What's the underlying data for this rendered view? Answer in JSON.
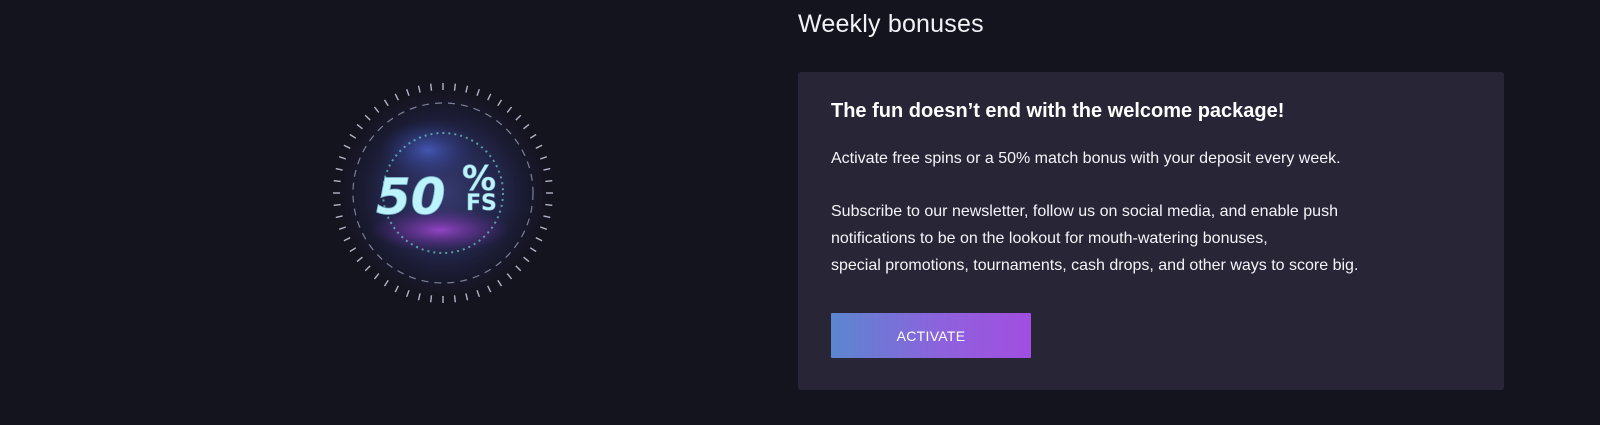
{
  "section": {
    "title": "Weekly bonuses"
  },
  "promo_art": {
    "number": "50",
    "percent_sign": "%",
    "suffix": "FS"
  },
  "card": {
    "heading": "The fun doesn’t end with the welcome package!",
    "paragraph_1": "Activate free spins or a 50% match bonus with your deposit every week.",
    "paragraph_2_lines": [
      "Subscribe to our newsletter, follow us on social media, and enable push",
      "notifications to be on the lookout for mouth-watering bonuses,",
      "special promotions, tournaments, cash drops, and other ways to score big."
    ],
    "button_label": "ACTIVATE"
  },
  "colors": {
    "page_background": "#14141e",
    "card_background": "#282536",
    "button_gradient_start": "#5b86cf",
    "button_gradient_end": "#a24ee0",
    "promo_text": "#bdf3fb"
  }
}
